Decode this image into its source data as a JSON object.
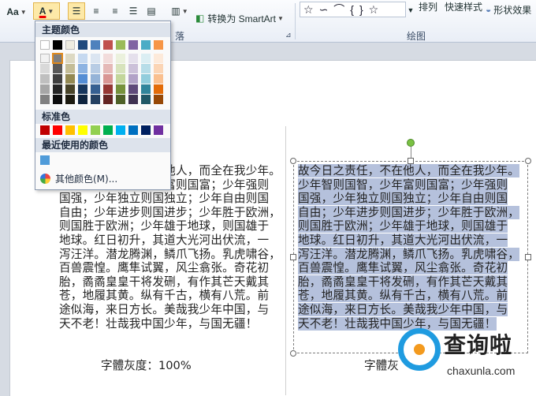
{
  "ribbon": {
    "aa_label": "Aa",
    "font_color_letter": "A",
    "smartart_label": "转换为 SmartArt",
    "arrange_label": "排列",
    "quick_styles_label": "快速样式",
    "shape_effects_label": "形状效果",
    "paragraph_group_label": "落",
    "drawing_group_label": "绘图"
  },
  "picker": {
    "theme_colors_title": "主题颜色",
    "standard_colors_title": "标准色",
    "recent_colors_title": "最近使用的颜色",
    "more_colors_label": "其他颜色(M)...",
    "theme_colors": [
      [
        "#ffffff",
        "#f2f2f2",
        "#d9d9d9",
        "#bfbfbf",
        "#a6a6a6",
        "#808080"
      ],
      [
        "#000000",
        "#7f7f7f",
        "#595959",
        "#404040",
        "#262626",
        "#0d0d0d"
      ],
      [
        "#eeece1",
        "#ddd9c3",
        "#c4bd97",
        "#938953",
        "#494429",
        "#1d1b10"
      ],
      [
        "#1f497d",
        "#c6d9f0",
        "#8db3e2",
        "#548dd4",
        "#17365d",
        "#0f243e"
      ],
      [
        "#4f81bd",
        "#dbe5f1",
        "#b8cce4",
        "#95b3d7",
        "#366092",
        "#244061"
      ],
      [
        "#c0504d",
        "#f2dcdb",
        "#e5b9b7",
        "#d99694",
        "#953734",
        "#632423"
      ],
      [
        "#9bbb59",
        "#ebf1dd",
        "#d7e3bc",
        "#c3d69b",
        "#76923c",
        "#4f6128"
      ],
      [
        "#8064a2",
        "#e5e0ec",
        "#ccc1d9",
        "#b2a2c7",
        "#5f497a",
        "#3f3151"
      ],
      [
        "#4bacc6",
        "#dbeef3",
        "#b7dde8",
        "#92cddc",
        "#31859b",
        "#205867"
      ],
      [
        "#f79646",
        "#fdeada",
        "#fbd5b5",
        "#fac08f",
        "#e36c09",
        "#974806"
      ]
    ],
    "standard_colors": [
      "#c00000",
      "#ff0000",
      "#ffc000",
      "#ffff00",
      "#92d050",
      "#00b050",
      "#00b0f0",
      "#0070c0",
      "#002060",
      "#7030a0"
    ],
    "recent_colors": [
      "#4f9bd9"
    ]
  },
  "document": {
    "left_lines": [
      "故今日之责任，不在他人，而全在我少年。",
      "少年智则国智，少年富则国富；少年强则",
      "国强，少年独立则国独立；少年自由则国",
      "自由；少年进步则国进步；少年胜于欧洲，",
      "则国胜于欧洲；少年雄于地球，则国雄于",
      "地球。红日初升，其道大光河出伏流，一",
      "泻汪洋。潜龙腾渊，鳞爪飞扬。乳虎啸谷，",
      "百兽震惶。鹰隼试翼，风尘翕张。奇花初",
      "胎，矞矞皇皇干将发硎，有作其芒天戴其",
      "苍，地履其黄。纵有千古，横有八荒。前",
      "途似海，来日方长。美哉我少年中国，与",
      "天不老！壮哉我中国少年，与国无疆！"
    ],
    "right_lines": [
      "故今日之责任，不在他人，而全在我少年。",
      "少年智则国智，少年富则国富；少年强则",
      "国强，少年独立则国独立；少年自由则国",
      "自由；少年进步则国进步；少年胜于欧洲，",
      "则国胜于欧洲；少年雄于地球，则国雄于",
      "地球。红日初升，其道大光河出伏流，一",
      "泻汪洋。潜龙腾渊，鳞爪飞扬。乳虎啸谷，",
      "百兽震惶。鹰隼试翼，风尘翕张。奇花初",
      "胎，矞矞皇皇干将发硎，有作其芒天戴其",
      "苍，地履其黄。纵有千古，横有八荒。前",
      "途似海，来日方长。美哉我少年中国，与",
      "天不老！壮哉我中国少年，与国无疆！"
    ],
    "caption_left": "字體灰度：100%",
    "caption_right": "字體灰"
  },
  "watermark": {
    "title": "查询啦",
    "subtitle": "chaxunla.com"
  }
}
